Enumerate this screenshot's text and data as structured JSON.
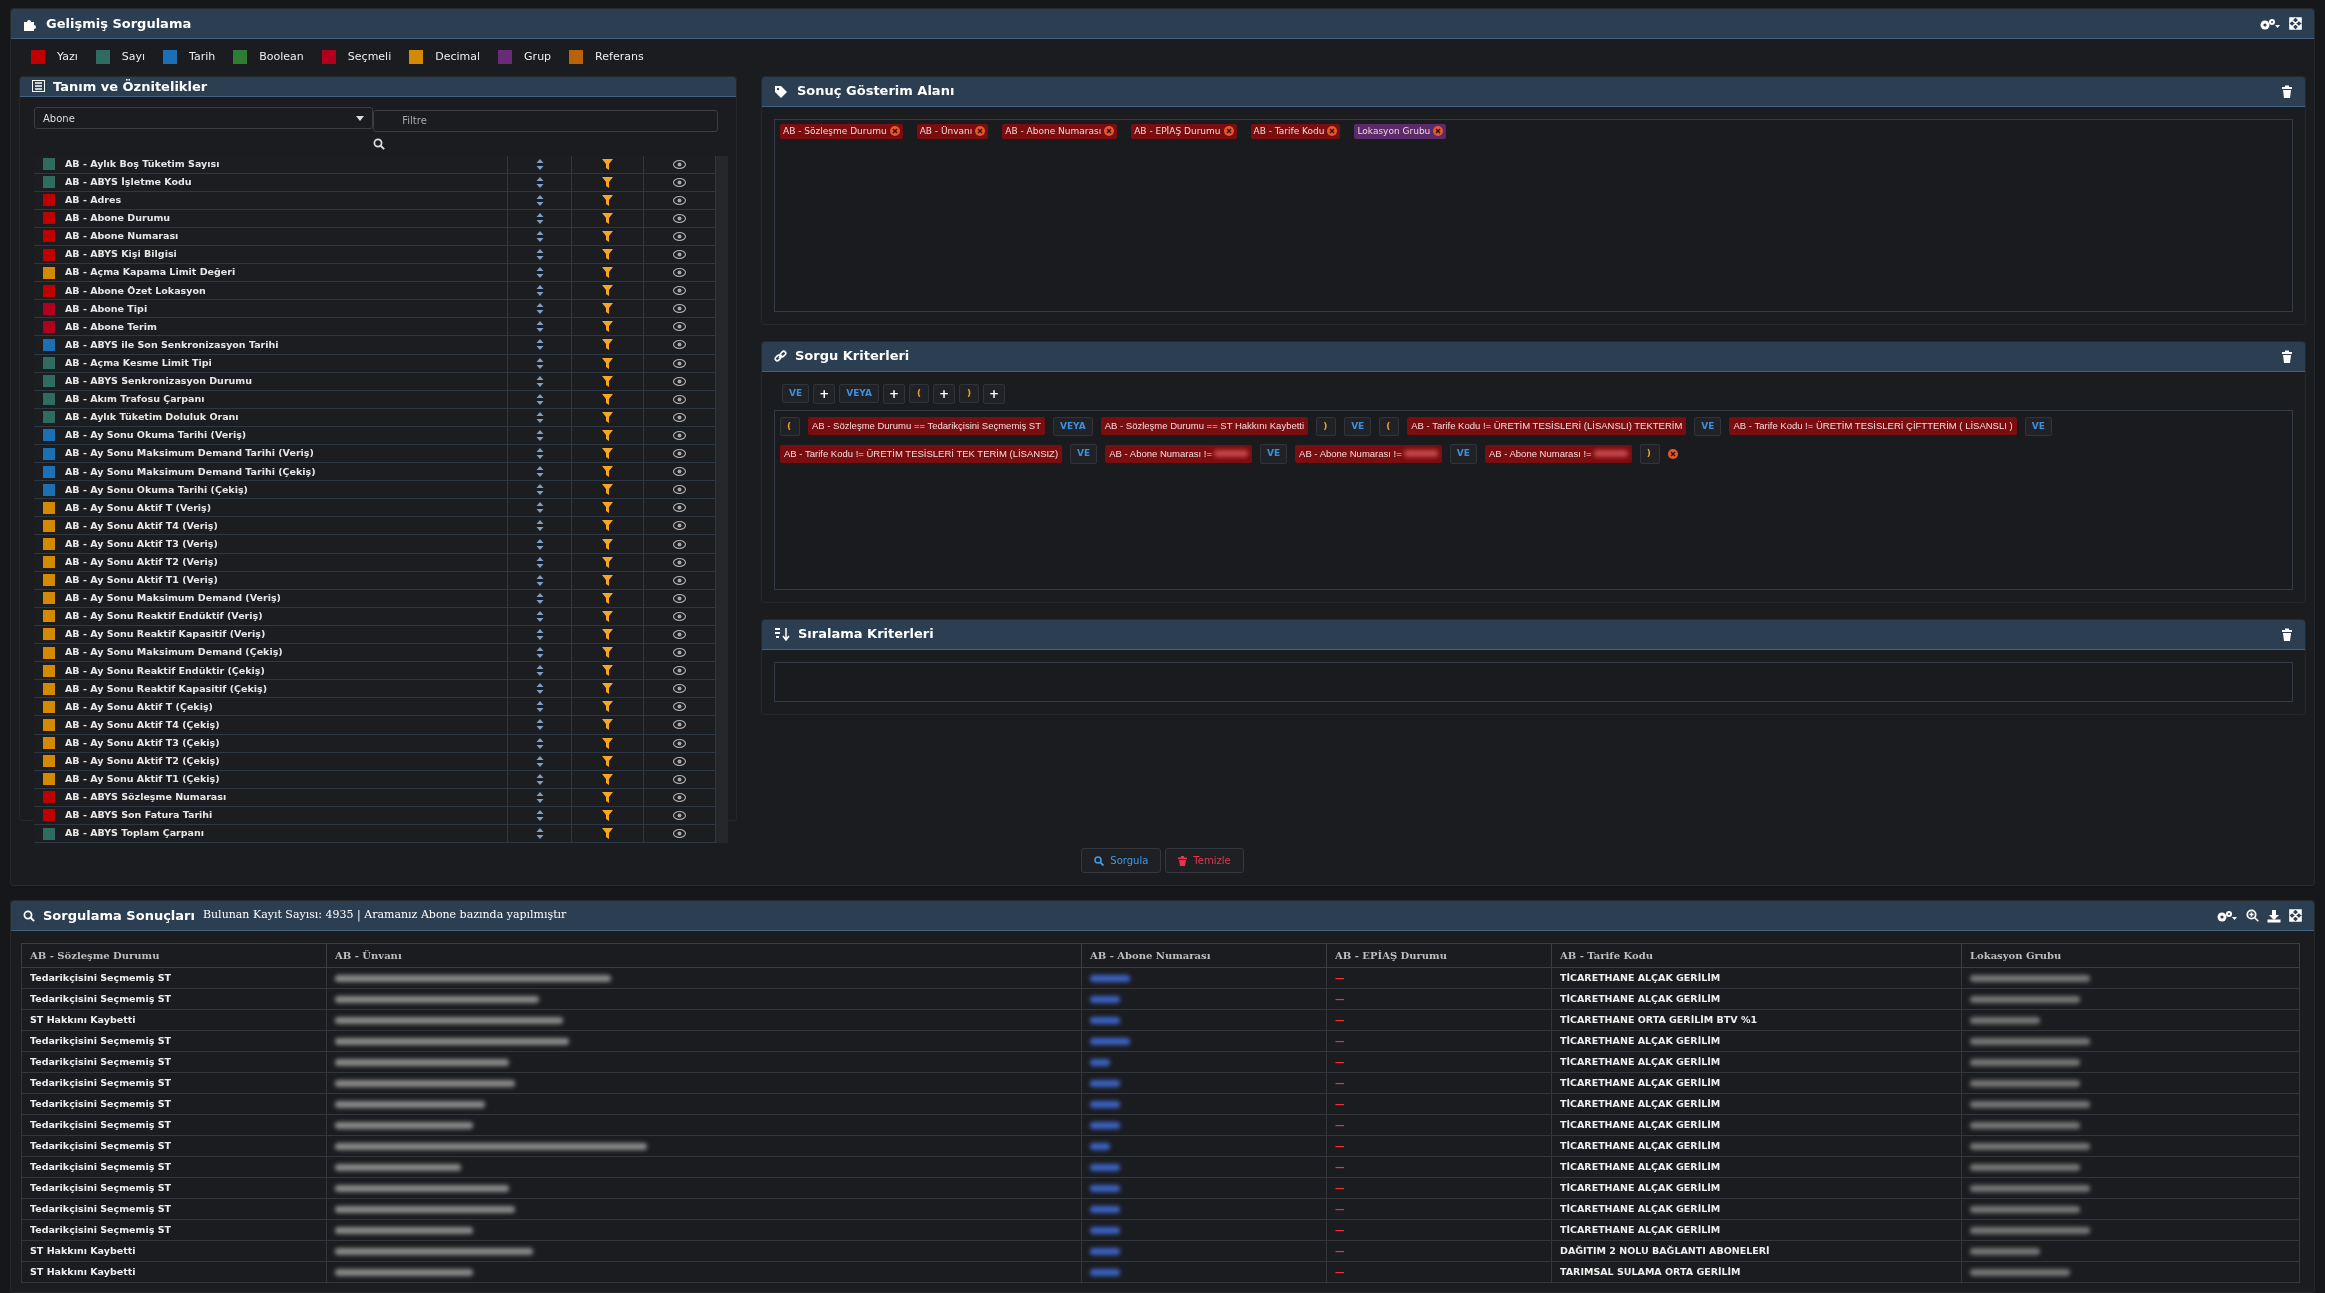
{
  "header": {
    "title": "Gelişmiş Sorgulama"
  },
  "legend": [
    {
      "label": "Yazı",
      "color": "#c00000"
    },
    {
      "label": "Sayı",
      "color": "#2f6b5f"
    },
    {
      "label": "Tarih",
      "color": "#1a6fb5"
    },
    {
      "label": "Boolean",
      "color": "#2e7d32"
    },
    {
      "label": "Seçmeli",
      "color": "#b0001e"
    },
    {
      "label": "Decimal",
      "color": "#d48a00"
    },
    {
      "label": "Grup",
      "color": "#6b2a78"
    },
    {
      "label": "Referans",
      "color": "#b8620a"
    }
  ],
  "definitions": {
    "title": "Tanım ve Öznitelikler",
    "entity": "Abone",
    "filter_placeholder": "Filtre",
    "attributes": [
      {
        "label": "AB - Aylık Boş Tüketim Sayısı",
        "color": "#2f6b5f"
      },
      {
        "label": "AB - ABYS İşletme Kodu",
        "color": "#2f6b5f"
      },
      {
        "label": "AB - Adres",
        "color": "#c00000"
      },
      {
        "label": "AB - Abone Durumu",
        "color": "#c00000"
      },
      {
        "label": "AB - Abone Numarası",
        "color": "#c00000"
      },
      {
        "label": "AB - ABYS Kişi Bilgisi",
        "color": "#c00000"
      },
      {
        "label": "AB - Açma Kapama Limit Değeri",
        "color": "#d48a00"
      },
      {
        "label": "AB - Abone Özet Lokasyon",
        "color": "#c00000"
      },
      {
        "label": "AB - Abone Tipi",
        "color": "#b0001e"
      },
      {
        "label": "AB - Abone Terim",
        "color": "#b0001e"
      },
      {
        "label": "AB - ABYS ile Son Senkronizasyon Tarihi",
        "color": "#1a6fb5"
      },
      {
        "label": "AB - Açma Kesme Limit Tipi",
        "color": "#2f6b5f"
      },
      {
        "label": "AB - ABYS Senkronizasyon Durumu",
        "color": "#2f6b5f"
      },
      {
        "label": "AB - Akım Trafosu Çarpanı",
        "color": "#2f6b5f"
      },
      {
        "label": "AB - Aylık Tüketim Doluluk Oranı",
        "color": "#2f6b5f"
      },
      {
        "label": "AB - Ay Sonu Okuma Tarihi (Veriş)",
        "color": "#1a6fb5"
      },
      {
        "label": "AB - Ay Sonu Maksimum Demand Tarihi (Veriş)",
        "color": "#1a6fb5"
      },
      {
        "label": "AB - Ay Sonu Maksimum Demand Tarihi (Çekiş)",
        "color": "#1a6fb5"
      },
      {
        "label": "AB - Ay Sonu Okuma Tarihi (Çekiş)",
        "color": "#1a6fb5"
      },
      {
        "label": "AB - Ay Sonu Aktif T (Veriş)",
        "color": "#d48a00"
      },
      {
        "label": "AB - Ay Sonu Aktif T4 (Veriş)",
        "color": "#d48a00"
      },
      {
        "label": "AB - Ay Sonu Aktif T3 (Veriş)",
        "color": "#d48a00"
      },
      {
        "label": "AB - Ay Sonu Aktif T2 (Veriş)",
        "color": "#d48a00"
      },
      {
        "label": "AB - Ay Sonu Aktif T1 (Veriş)",
        "color": "#d48a00"
      },
      {
        "label": "AB - Ay Sonu Maksimum Demand (Veriş)",
        "color": "#d48a00"
      },
      {
        "label": "AB - Ay Sonu Reaktif Endüktif (Veriş)",
        "color": "#d48a00"
      },
      {
        "label": "AB - Ay Sonu Reaktif Kapasitif (Veriş)",
        "color": "#d48a00"
      },
      {
        "label": "AB - Ay Sonu Maksimum Demand (Çekiş)",
        "color": "#d48a00"
      },
      {
        "label": "AB - Ay Sonu Reaktif Endüktir (Çekiş)",
        "color": "#d48a00"
      },
      {
        "label": "AB - Ay Sonu Reaktif Kapasitif (Çekiş)",
        "color": "#d48a00"
      },
      {
        "label": "AB - Ay Sonu Aktif T (Çekiş)",
        "color": "#d48a00"
      },
      {
        "label": "AB - Ay Sonu Aktif T4 (Çekiş)",
        "color": "#d48a00"
      },
      {
        "label": "AB - Ay Sonu Aktif T3 (Çekiş)",
        "color": "#d48a00"
      },
      {
        "label": "AB - Ay Sonu Aktif T2 (Çekiş)",
        "color": "#d48a00"
      },
      {
        "label": "AB - Ay Sonu Aktif T1 (Çekiş)",
        "color": "#d48a00"
      },
      {
        "label": "AB - ABYS Sözleşme Numarası",
        "color": "#c00000"
      },
      {
        "label": "AB - ABYS Son Fatura Tarihi",
        "color": "#c00000"
      },
      {
        "label": "AB - ABYS Toplam Çarpanı",
        "color": "#2f6b5f"
      }
    ]
  },
  "result_area": {
    "title": "Sonuç Gösterim Alanı",
    "fields": [
      {
        "label": "AB - Sözleşme Durumu",
        "color": "#7a0d10"
      },
      {
        "label": "AB - Ünvanı",
        "color": "#7a0d10"
      },
      {
        "label": "AB - Abone Numarası",
        "color": "#7a0d10"
      },
      {
        "label": "AB - EPİAŞ Durumu",
        "color": "#7a0d10"
      },
      {
        "label": "AB - Tarife Kodu",
        "color": "#7a0d10"
      },
      {
        "label": "Lokasyon Grubu",
        "color": "#5b2a6b"
      }
    ]
  },
  "query_criteria": {
    "title": "Sorgu Kriterleri",
    "tools": [
      {
        "kind": "op",
        "label": "VE"
      },
      {
        "kind": "add",
        "label": "+"
      },
      {
        "kind": "op",
        "label": "VEYA"
      },
      {
        "kind": "add",
        "label": "+"
      },
      {
        "kind": "paren",
        "label": "("
      },
      {
        "kind": "add",
        "label": "+"
      },
      {
        "kind": "paren",
        "label": ")"
      },
      {
        "kind": "add",
        "label": "+"
      }
    ],
    "criteria": [
      {
        "kind": "paren",
        "text": "("
      },
      {
        "kind": "condition",
        "text": "AB - Sözleşme Durumu == Tedarikçisini Seçmemiş ST",
        "redacted": false
      },
      {
        "kind": "op",
        "text": "VEYA"
      },
      {
        "kind": "condition",
        "text": "AB - Sözleşme Durumu == ST Hakkını Kaybetti",
        "redacted": false
      },
      {
        "kind": "paren",
        "text": ")"
      },
      {
        "kind": "op",
        "text": "VE"
      },
      {
        "kind": "paren",
        "text": "("
      },
      {
        "kind": "condition",
        "text": "AB - Tarife Kodu != ÜRETİM TESİSLERİ (LİSANSLI) TEKTERİM",
        "redacted": false
      },
      {
        "kind": "op",
        "text": "VE"
      },
      {
        "kind": "condition",
        "text": "AB - Tarife Kodu != ÜRETİM TESİSLERİ ÇİFTTERİM ( LİSANSLI )",
        "redacted": false
      },
      {
        "kind": "op",
        "text": "VE"
      },
      {
        "kind": "condition",
        "text": "AB - Tarife Kodu != ÜRETİM TESİSLERİ TEK TERİM (LİSANSIZ)",
        "redacted": false
      },
      {
        "kind": "op",
        "text": "VE"
      },
      {
        "kind": "condition",
        "text": "AB - Abone Numarası !=",
        "redacted": true
      },
      {
        "kind": "op",
        "text": "VE"
      },
      {
        "kind": "condition",
        "text": "AB - Abone Numarası !=",
        "redacted": true
      },
      {
        "kind": "op",
        "text": "VE"
      },
      {
        "kind": "condition",
        "text": "AB - Abone Numarası !=",
        "redacted": true
      },
      {
        "kind": "paren",
        "text": ")"
      },
      {
        "kind": "remove"
      }
    ]
  },
  "sort_criteria": {
    "title": "Sıralama Kriterleri"
  },
  "actions": [
    {
      "kind": "search",
      "label": "Sorgula"
    },
    {
      "kind": "clear",
      "label": "Temizle"
    }
  ],
  "results": {
    "title": "Sorgulama Sonuçları",
    "summary": "Bulunan Kayıt Sayısı: 4935 | Aramanız Abone bazında yapılmıştır",
    "columns": [
      "AB - Sözleşme Durumu",
      "AB - Ünvanı",
      "AB - Abone Numarası",
      "AB - EPİAŞ Durumu",
      "AB - Tarife Kodu",
      "Lokasyon Grubu"
    ],
    "rows": [
      {
        "status": "Tedarikçisini Seçmemiş ST",
        "epias": "—",
        "tariff": "TİCARETHANE ALÇAK GERİLİM"
      },
      {
        "status": "Tedarikçisini Seçmemiş ST",
        "epias": "—",
        "tariff": "TİCARETHANE ALÇAK GERİLİM"
      },
      {
        "status": "ST Hakkını Kaybetti",
        "epias": "—",
        "tariff": "TİCARETHANE ORTA GERİLİM BTV %1"
      },
      {
        "status": "Tedarikçisini Seçmemiş ST",
        "epias": "—",
        "tariff": "TİCARETHANE ALÇAK GERİLİM"
      },
      {
        "status": "Tedarikçisini Seçmemiş ST",
        "epias": "—",
        "tariff": "TİCARETHANE ALÇAK GERİLİM"
      },
      {
        "status": "Tedarikçisini Seçmemiş ST",
        "epias": "—",
        "tariff": "TİCARETHANE ALÇAK GERİLİM"
      },
      {
        "status": "Tedarikçisini Seçmemiş ST",
        "epias": "—",
        "tariff": "TİCARETHANE ALÇAK GERİLİM"
      },
      {
        "status": "Tedarikçisini Seçmemiş ST",
        "epias": "—",
        "tariff": "TİCARETHANE ALÇAK GERİLİM"
      },
      {
        "status": "Tedarikçisini Seçmemiş ST",
        "epias": "—",
        "tariff": "TİCARETHANE ALÇAK GERİLİM"
      },
      {
        "status": "Tedarikçisini Seçmemiş ST",
        "epias": "—",
        "tariff": "TİCARETHANE ALÇAK GERİLİM"
      },
      {
        "status": "Tedarikçisini Seçmemiş ST",
        "epias": "—",
        "tariff": "TİCARETHANE ALÇAK GERİLİM"
      },
      {
        "status": "Tedarikçisini Seçmemiş ST",
        "epias": "—",
        "tariff": "TİCARETHANE ALÇAK GERİLİM"
      },
      {
        "status": "Tedarikçisini Seçmemiş ST",
        "epias": "—",
        "tariff": "TİCARETHANE ALÇAK GERİLİM"
      },
      {
        "status": "ST Hakkını Kaybetti",
        "epias": "—",
        "tariff": "DAĞITIM 2 NOLU BAĞLANTI ABONELERİ"
      },
      {
        "status": "ST Hakkını Kaybetti",
        "epias": "—",
        "tariff": "TARIMSAL SULAMA ORTA GERİLİM"
      }
    ]
  }
}
